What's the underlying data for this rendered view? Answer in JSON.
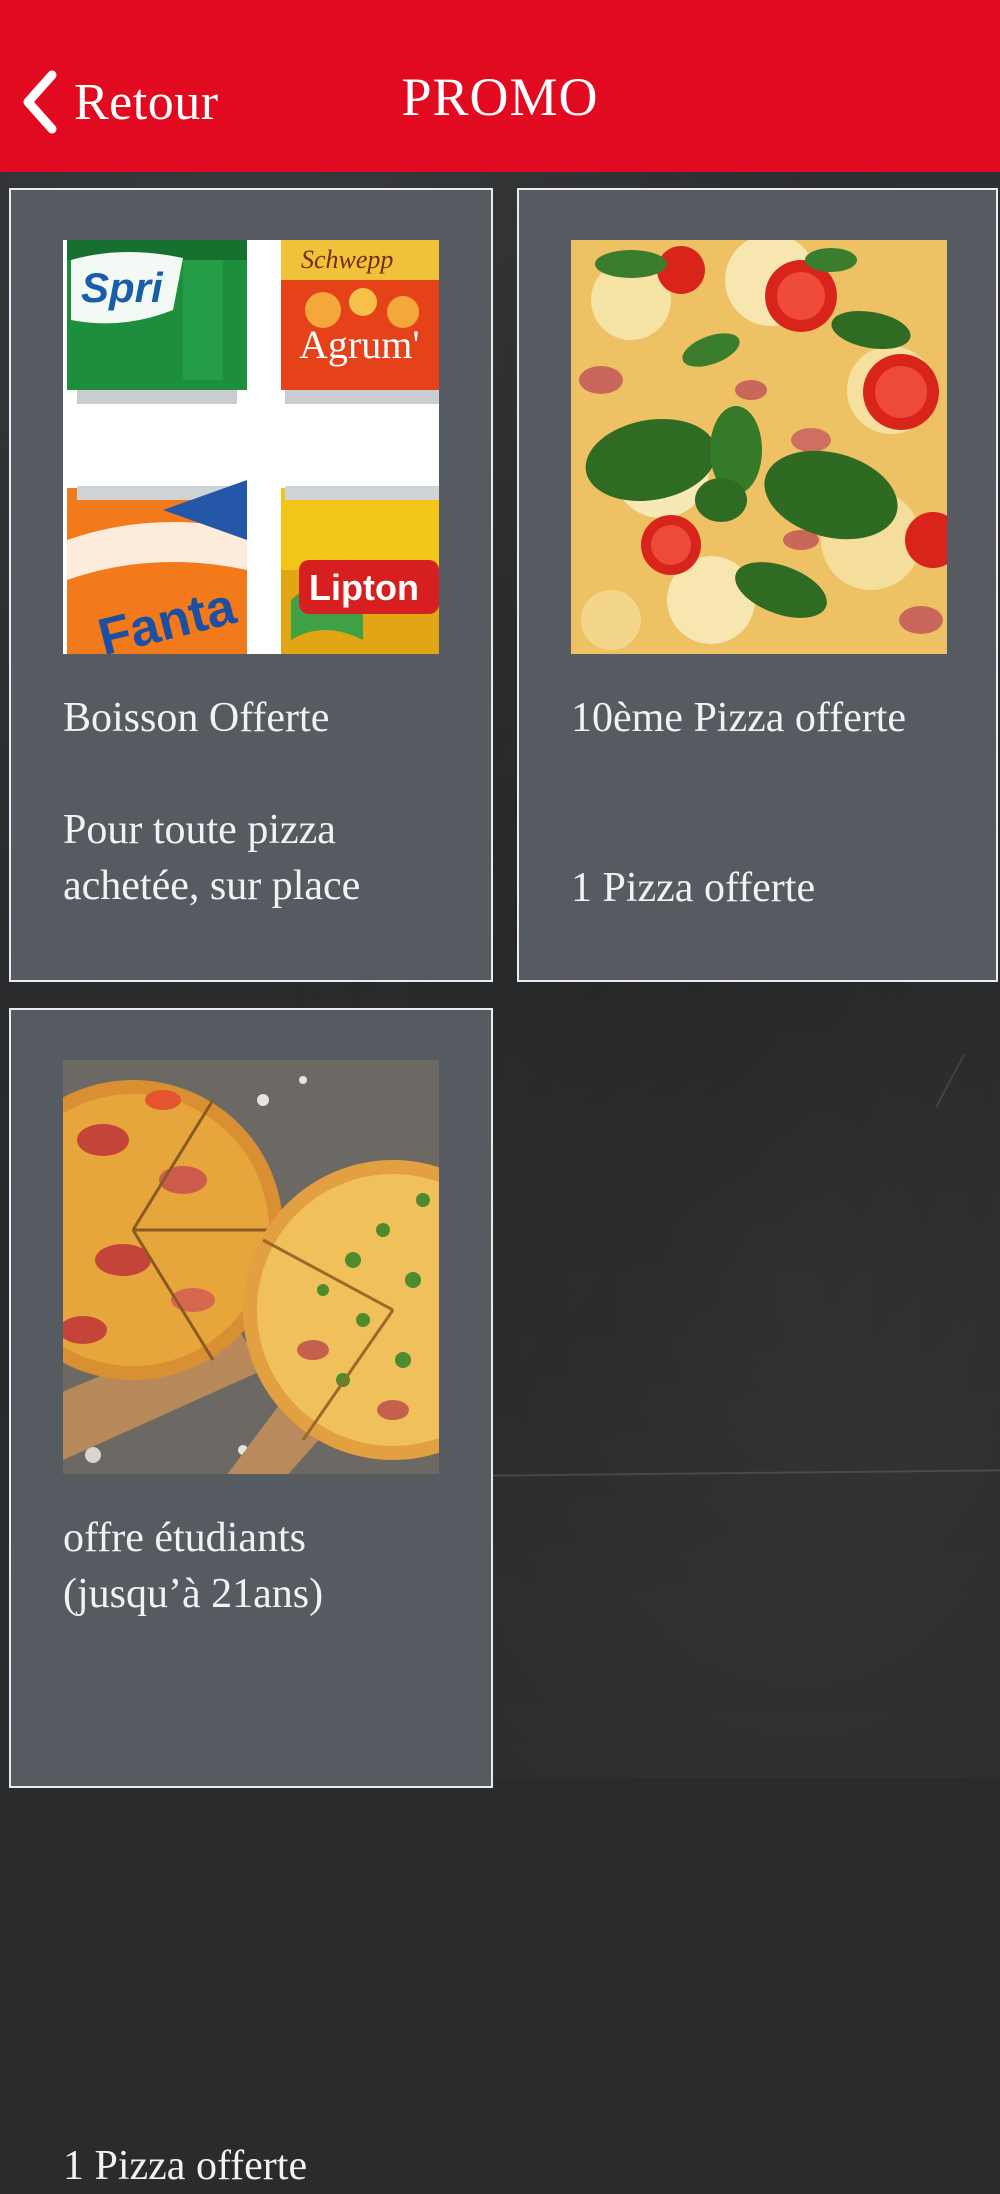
{
  "header": {
    "back_label": "Retour",
    "title": "PROMO",
    "bg_color": "#e10a20"
  },
  "promos": [
    {
      "title": "Boisson Offerte",
      "description": "Pour toute pizza achetée, sur place",
      "image": "soda-cans",
      "image_text": [
        "Spri",
        "Schwepp",
        "Agrum'",
        "Fanta",
        "Lipton"
      ]
    },
    {
      "title": "10ème Pizza offerte",
      "description": "1 Pizza offerte",
      "image": "basil-pizza"
    },
    {
      "title": "offre étudiants (jusqu’à 21ans)",
      "description": "1 Pizza offerte",
      "image": "two-pizzas"
    }
  ]
}
